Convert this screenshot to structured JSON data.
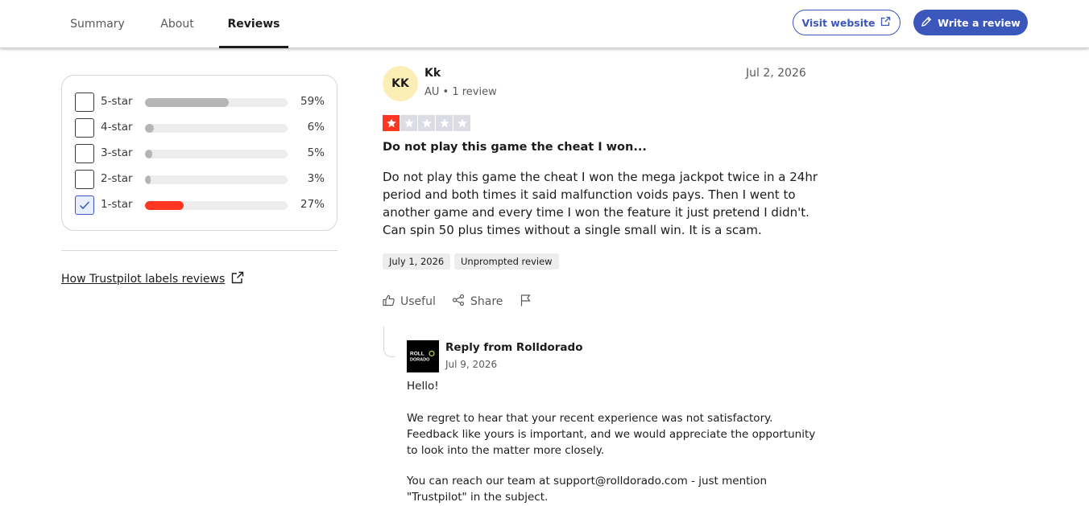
{
  "nav": {
    "tabs": [
      {
        "label": "Summary"
      },
      {
        "label": "About"
      },
      {
        "label": "Reviews"
      }
    ],
    "visit_label": "Visit website",
    "write_label": "Write a review"
  },
  "filters": {
    "rows": [
      {
        "label": "5-star",
        "percent": "59%",
        "value": 59,
        "checked": false
      },
      {
        "label": "4-star",
        "percent": "6%",
        "value": 6,
        "checked": false
      },
      {
        "label": "3-star",
        "percent": "5%",
        "value": 5,
        "checked": false
      },
      {
        "label": "2-star",
        "percent": "3%",
        "value": 3,
        "checked": false
      },
      {
        "label": "1-star",
        "percent": "27%",
        "value": 27,
        "checked": true
      }
    ],
    "labels_link": "How Trustpilot labels reviews"
  },
  "review": {
    "initials": "KK",
    "name": "Kk",
    "meta": "AU • 1 review",
    "date": "Jul 2, 2026",
    "rating": 1,
    "title": "Do not play this game the cheat I won...",
    "body": "Do not play this game the cheat I won the mega jackpot twice in a 24hr period and both times it said malfunction voids pays. Then I went to another game and every time I won the feature it just pretend I didn't. Can spin 50 plus times without a single small win. It is a scam.",
    "experience_date": "July 1, 2026",
    "tag": "Unprompted review",
    "useful_label": "Useful",
    "share_label": "Share"
  },
  "reply": {
    "logo_text_top": "ROLL",
    "logo_text_bottom": "DORADO",
    "from": "Reply from Rolldorado",
    "date": "Jul 9, 2026",
    "greeting": "Hello!",
    "paragraph1": "We regret to hear that your recent experience was not satisfactory. Feedback like yours is important, and we would appreciate the opportunity to look into the matter more closely.",
    "paragraph2": "You can reach our team at support@rolldorado.com - just mention \"Trustpilot\" in the subject."
  },
  "colors": {
    "brand_blue": "#3c57bc",
    "star_red": "#ff3722",
    "bar_gray": "#b5b5b5",
    "avatar_yellow": "#fbefb6"
  }
}
